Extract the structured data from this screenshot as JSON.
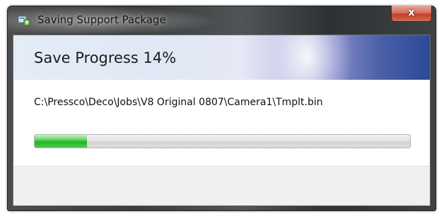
{
  "window": {
    "title": "Saving Support Package",
    "close_label": "x"
  },
  "header": {
    "title": "Save Progress 14%"
  },
  "body": {
    "file_path": "C:\\Pressco\\Deco\\Jobs\\V8 Original 0807\\Camera1\\Tmplt.bin"
  },
  "progress": {
    "percent": 14
  },
  "icons": {
    "app_icon": "package-save-icon",
    "close_icon": "close-icon"
  },
  "colors": {
    "progress_green": "#25b427",
    "close_red": "#c2412b",
    "header_blue": "#2b4a96"
  }
}
